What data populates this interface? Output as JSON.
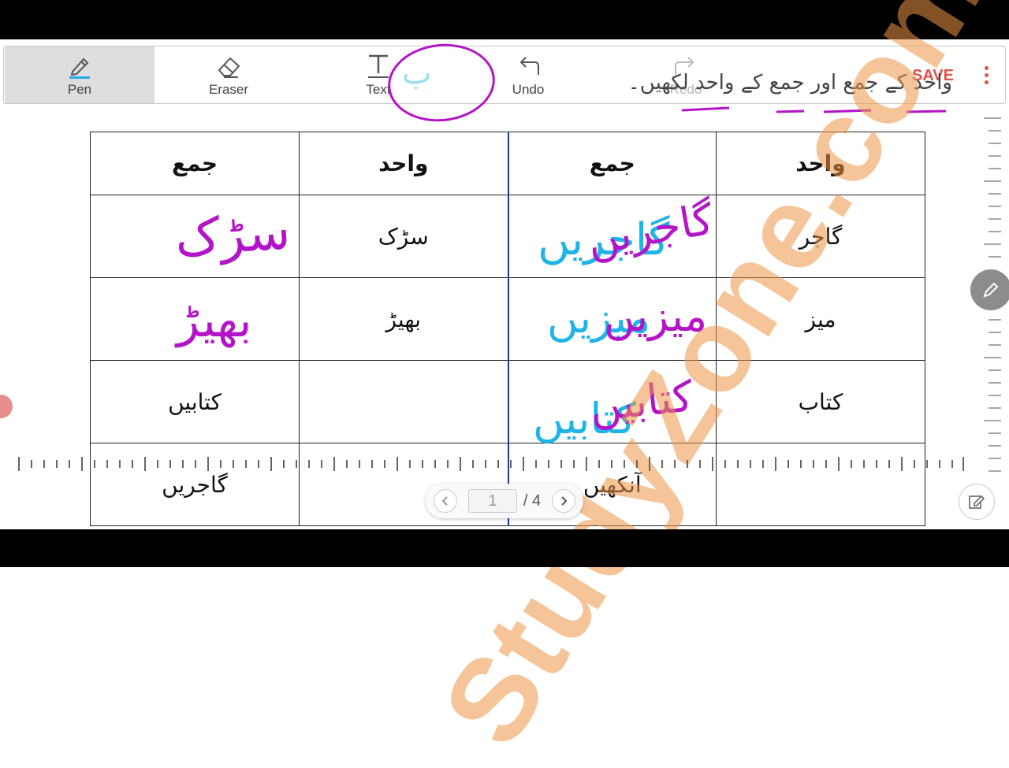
{
  "toolbar": {
    "tools": [
      {
        "label": "Pen",
        "icon": "pen-icon",
        "active": true
      },
      {
        "label": "Eraser",
        "icon": "eraser-icon"
      },
      {
        "label": "Text",
        "icon": "text-icon"
      },
      {
        "label": "Undo",
        "icon": "undo-icon"
      },
      {
        "label": "Redo",
        "icon": "redo-icon",
        "disabled": true
      }
    ],
    "save_label": "SAVE",
    "more_icon": "more-vert-icon",
    "accent_color": "#e0504a"
  },
  "instruction": "واحد کے جمع اور جمع کے واحد لکھیں۔",
  "page_label": "ب",
  "table": {
    "headers": [
      "جمع",
      "واحد",
      "جمع",
      "واحد"
    ],
    "rows": [
      [
        "",
        "سڑک",
        "",
        "گاجر"
      ],
      [
        "",
        "بھیڑ",
        "",
        "میز"
      ],
      [
        "کتابیں",
        "",
        "",
        "کتاب"
      ],
      [
        "گاجریں",
        "",
        "آنکھیں",
        ""
      ]
    ]
  },
  "handwriting": {
    "purple": [
      "سڑک",
      "بھیڑ",
      "گاجریں",
      "میزیں",
      "کتابیں"
    ],
    "cyan": [
      "گاجریں",
      "میزیں",
      "کتابیں"
    ],
    "colors": {
      "purple": "#b414c8",
      "cyan": "#1eb4e6"
    }
  },
  "watermark": "StudyZone.com",
  "pager": {
    "current": "1",
    "total": "/ 4",
    "prev_icon": "chevron-left-icon",
    "next_icon": "chevron-right-icon"
  },
  "fabs": {
    "pen_icon": "pencil-icon",
    "edit_icon": "edit-icon"
  }
}
